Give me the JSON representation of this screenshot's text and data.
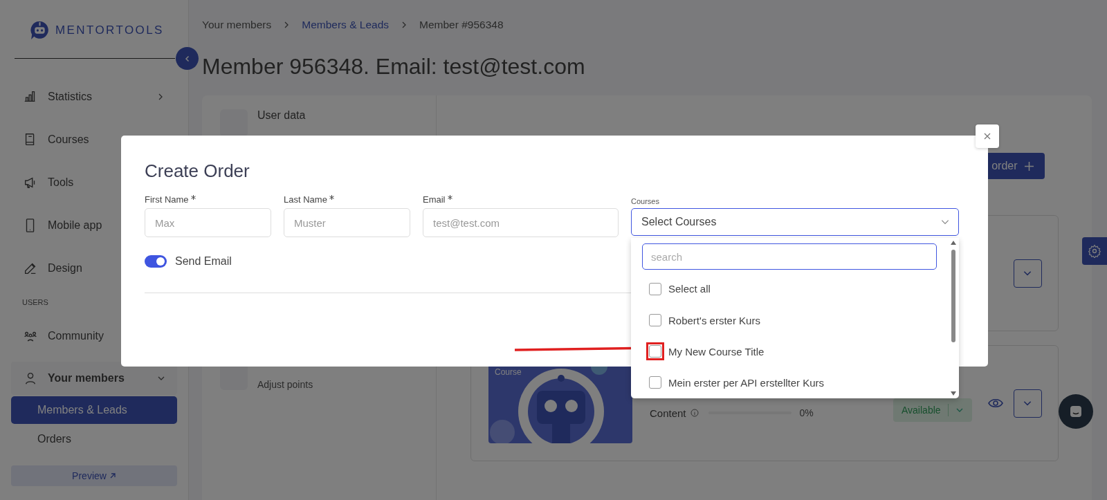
{
  "sidebar": {
    "logo": "MENTORTOOLS",
    "items": [
      {
        "kind": "item",
        "label": "Statistics",
        "expanded": false
      },
      {
        "kind": "item",
        "label": "Courses"
      },
      {
        "kind": "item",
        "label": "Tools"
      },
      {
        "kind": "item",
        "label": "Mobile app"
      },
      {
        "kind": "item",
        "label": "Design"
      },
      {
        "kind": "section",
        "label": "USERS"
      },
      {
        "kind": "item",
        "label": "Community"
      },
      {
        "kind": "item",
        "label": "Your members",
        "expanded": true,
        "children": [
          {
            "label": "Members & Leads",
            "selected": true
          },
          {
            "label": "Orders",
            "selected": false
          }
        ]
      }
    ],
    "preview_button": "Preview"
  },
  "breadcrumb": [
    {
      "label": "Your members",
      "link": false
    },
    {
      "label": "Members & Leads",
      "link": true
    },
    {
      "label": "Member #956348",
      "link": false
    }
  ],
  "page_title": "Member 956348. Email: test@test.com",
  "panel": {
    "sections": [
      {
        "title": "User data"
      },
      {
        "subtitle": "Adjust points"
      }
    ],
    "order_button": "order",
    "course_card": {
      "tag": "Course",
      "content_label": "Content",
      "level": 0,
      "reading": "0%",
      "status": "Available"
    }
  },
  "modal": {
    "title": "Create Order",
    "fields": [
      {
        "label": "First Name",
        "required": true,
        "placeholder": "Max"
      },
      {
        "label": "Last Name",
        "required": true,
        "placeholder": "Muster"
      },
      {
        "label": "Email",
        "required": true,
        "placeholder": "test@test.com"
      }
    ],
    "courses": {
      "label": "Courses",
      "placeholder": "Select Courses",
      "open": true,
      "search_placeholder": "search",
      "options": [
        {
          "label": "Select all",
          "checked": false,
          "highlighted": false
        },
        {
          "label": "Robert's erster Kurs",
          "checked": false,
          "highlighted": false
        },
        {
          "label": "My New Course Title",
          "checked": false,
          "highlighted": true
        },
        {
          "label": "Mein erster per API erstellter Kurs",
          "checked": false,
          "highlighted": false
        }
      ]
    },
    "send_email": {
      "label": "Send Email",
      "on": true
    }
  }
}
